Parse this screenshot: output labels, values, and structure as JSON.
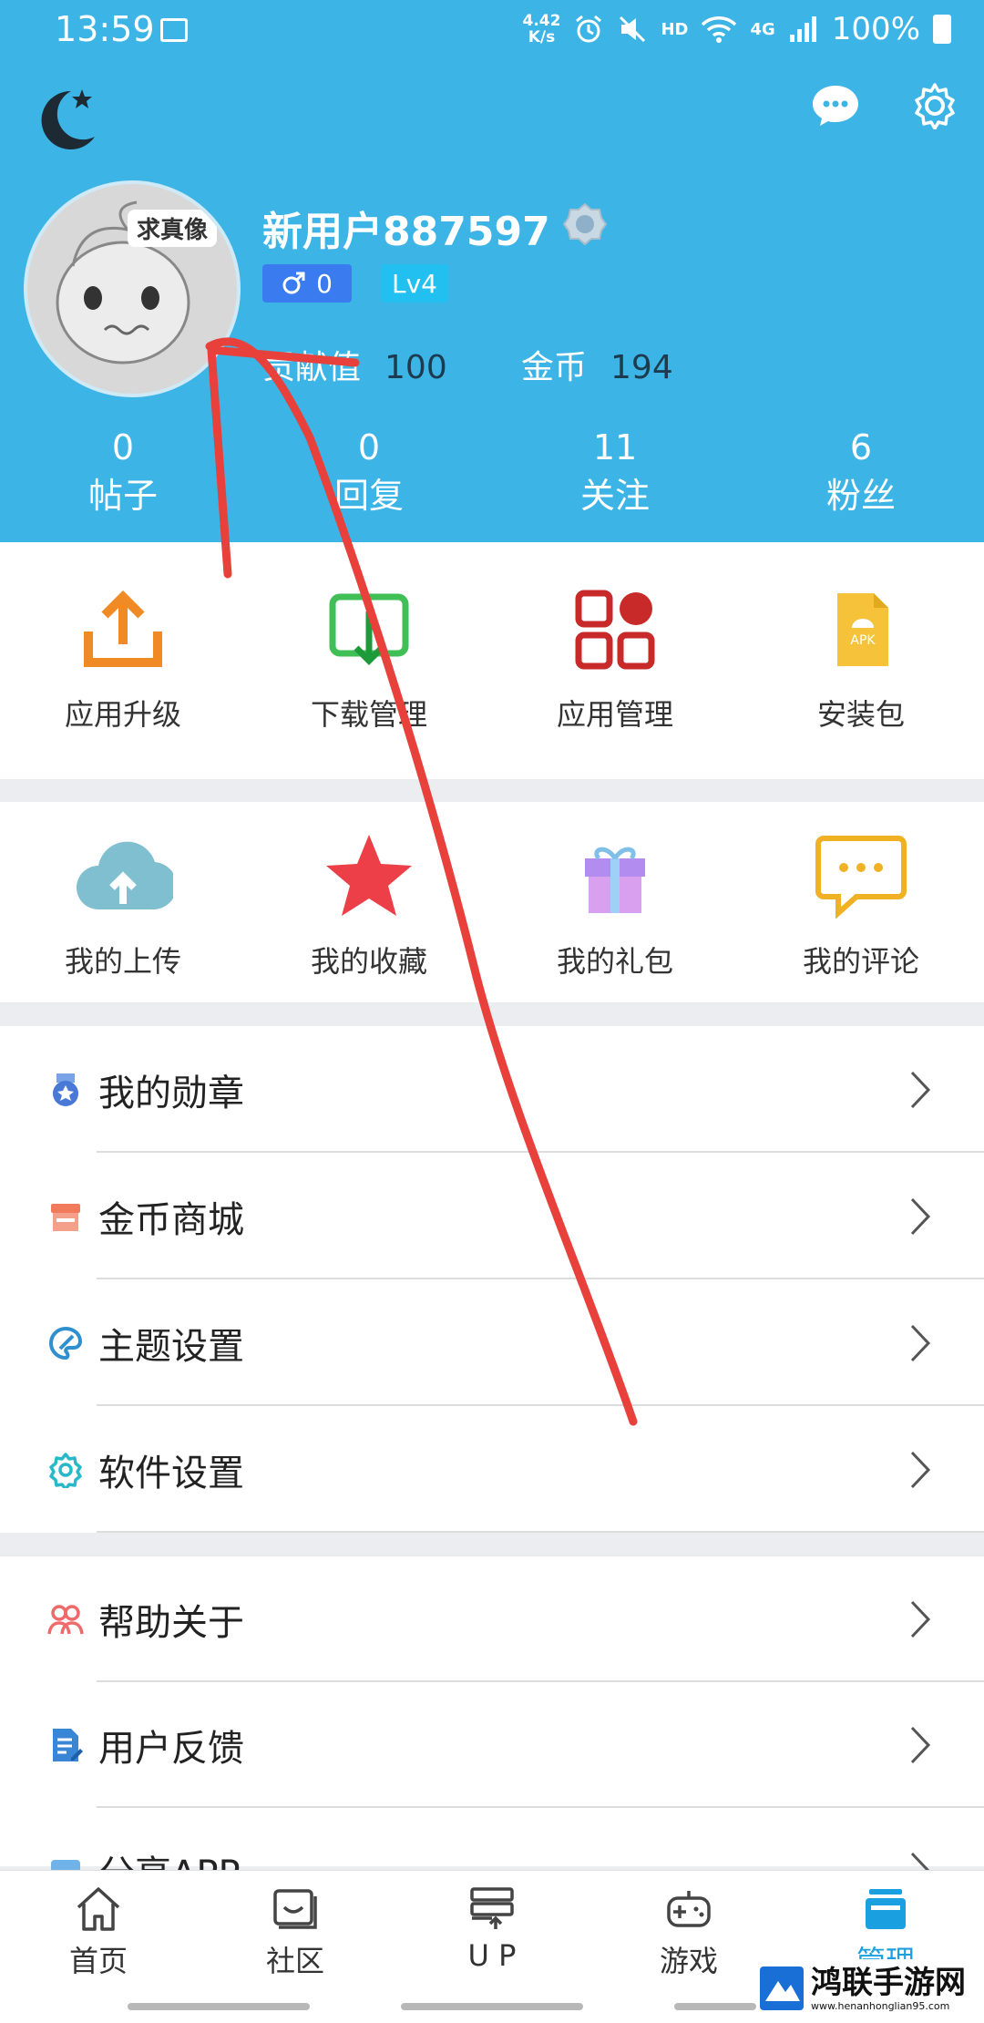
{
  "status_bar": {
    "time": "13:59",
    "speed_value": "4.42",
    "speed_unit": "K/s",
    "hd": "HD",
    "network": "4G",
    "battery": "100%"
  },
  "header": {
    "avatar_tag": "求真像",
    "username": "新用户887597",
    "gender_value": "0",
    "level": "Lv4",
    "contribution_label": "贡献值",
    "contribution_value": "100",
    "coins_label": "金币",
    "coins_value": "194"
  },
  "counts": [
    {
      "num": "0",
      "label": "帖子"
    },
    {
      "num": "0",
      "label": "回复"
    },
    {
      "num": "11",
      "label": "关注"
    },
    {
      "num": "6",
      "label": "粉丝"
    }
  ],
  "grid1": [
    {
      "label": "应用升级",
      "icon": "upload-icon"
    },
    {
      "label": "下载管理",
      "icon": "download-icon"
    },
    {
      "label": "应用管理",
      "icon": "apps-icon"
    },
    {
      "label": "安装包",
      "icon": "apk-icon"
    }
  ],
  "grid2": [
    {
      "label": "我的上传",
      "icon": "cloud-upload-icon"
    },
    {
      "label": "我的收藏",
      "icon": "star-icon"
    },
    {
      "label": "我的礼包",
      "icon": "gift-icon"
    },
    {
      "label": "我的评论",
      "icon": "comment-icon"
    }
  ],
  "list1": [
    {
      "label": "我的勋章",
      "icon": "medal-icon"
    },
    {
      "label": "金币商城",
      "icon": "shop-icon"
    },
    {
      "label": "主题设置",
      "icon": "palette-icon"
    },
    {
      "label": "软件设置",
      "icon": "settings-icon"
    }
  ],
  "list2": [
    {
      "label": "帮助关于",
      "icon": "help-icon"
    },
    {
      "label": "用户反馈",
      "icon": "feedback-icon"
    },
    {
      "label": "分享APP",
      "icon": "share-icon"
    }
  ],
  "bottom_nav": [
    {
      "label": "首页",
      "icon": "home-icon",
      "active": false
    },
    {
      "label": "社区",
      "icon": "community-icon",
      "active": false
    },
    {
      "label": "U P",
      "icon": "up-icon",
      "active": false
    },
    {
      "label": "游戏",
      "icon": "gamepad-icon",
      "active": false
    },
    {
      "label": "管理",
      "icon": "manage-icon",
      "active": true
    }
  ],
  "watermark": {
    "title": "鸿联手游网",
    "url": "www.henanhonglian95.com"
  },
  "colors": {
    "header_bg": "#3cb4e6",
    "active_tab": "#1a9fe0",
    "annotation": "#e8413c"
  }
}
